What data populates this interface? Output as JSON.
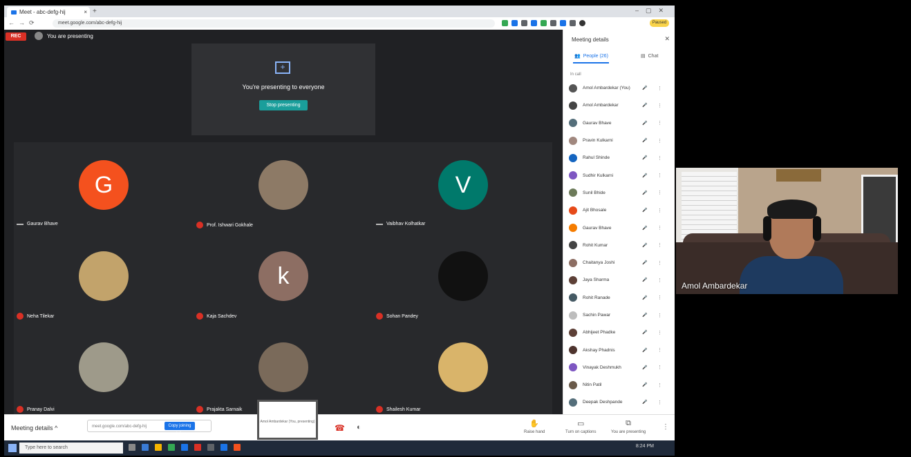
{
  "browser": {
    "tab_title": "Meet - abc-defg-hij",
    "url": "meet.google.com/abc-defg-hij",
    "profile": "Paused"
  },
  "meet": {
    "rec_label": "REC",
    "presenting_label": "You are presenting",
    "present_card": {
      "title": "You're presenting to everyone",
      "stop_button": "Stop presenting"
    },
    "tiles": [
      {
        "initial": "G",
        "name": "Gaurav Bhave",
        "bg": "#f4511e",
        "mic": "dash"
      },
      {
        "initial": "",
        "name": "Prof. Ishwari Gokhale",
        "bg": "#8d7a66",
        "mic": "muted"
      },
      {
        "initial": "V",
        "name": "Vaibhav Kolhatkar",
        "bg": "#00796b",
        "mic": "dash"
      },
      {
        "initial": "",
        "name": "Neha Tilekar",
        "bg": "#c2a36b",
        "mic": "muted"
      },
      {
        "initial": "k",
        "name": "Kaja Sachdev",
        "bg": "#8d6e63",
        "mic": "muted"
      },
      {
        "initial": "",
        "name": "Sohan Pandey",
        "bg": "#111111",
        "mic": "muted"
      },
      {
        "initial": "",
        "name": "Pranay Dalvi",
        "bg": "#9e9a8a",
        "mic": "muted"
      },
      {
        "initial": "",
        "name": "Prajakta Sarnaik",
        "bg": "#7a6a5a",
        "mic": "muted"
      },
      {
        "initial": "",
        "name": "Shailesh Kumar",
        "bg": "#d9b46a",
        "mic": "muted"
      }
    ],
    "presentation_thumb_label": "Amol Ambardekar (You, presenting)"
  },
  "bottombar": {
    "meeting_details": "Meeting details",
    "joining_info": "meet.google.com/abc-defg-hij",
    "copy_button": "Copy joining info",
    "raise_hand": "Raise hand",
    "captions": "Turn on captions",
    "stop_presenting": "You are presenting"
  },
  "taskbar": {
    "search_placeholder": "Type here to search",
    "time": "8:24 PM"
  },
  "panel": {
    "title": "Meeting details",
    "tab_people": "People (26)",
    "tab_chat": "Chat",
    "in_call": "In call",
    "participants": [
      {
        "name": "Amol Ambardekar (You)",
        "color": "#555"
      },
      {
        "name": "Amol Ambardekar",
        "color": "#444"
      },
      {
        "name": "Gaurav Bhave",
        "color": "#546e7a"
      },
      {
        "name": "Pravin Kulkarni",
        "color": "#a1887f"
      },
      {
        "name": "Rahul Shinde",
        "color": "#1565c0"
      },
      {
        "name": "Sudhir Kulkarni",
        "color": "#7e57c2"
      },
      {
        "name": "Sunil Bhide",
        "color": "#6d7b5a"
      },
      {
        "name": "Ajit Bhosale",
        "color": "#e64a19"
      },
      {
        "name": "Gaurav Bhave",
        "color": "#f57c00"
      },
      {
        "name": "Rohit Kumar",
        "color": "#444"
      },
      {
        "name": "Chaitanya Joshi",
        "color": "#8d6e63"
      },
      {
        "name": "Jaya Sharma",
        "color": "#5d4037"
      },
      {
        "name": "Rohit Ranade",
        "color": "#455a64"
      },
      {
        "name": "Sachin Pawar",
        "color": "#bdbdbd"
      },
      {
        "name": "Abhijeet Phadke",
        "color": "#5d4037"
      },
      {
        "name": "Akshay Phadnis",
        "color": "#4e342e"
      },
      {
        "name": "Vinayak Deshmukh",
        "color": "#7e57c2"
      },
      {
        "name": "Nitin Patil",
        "color": "#6a5a4a"
      },
      {
        "name": "Deepak Deshpande",
        "color": "#546e7a"
      }
    ]
  },
  "webcam": {
    "name": "Amol Ambardekar"
  }
}
